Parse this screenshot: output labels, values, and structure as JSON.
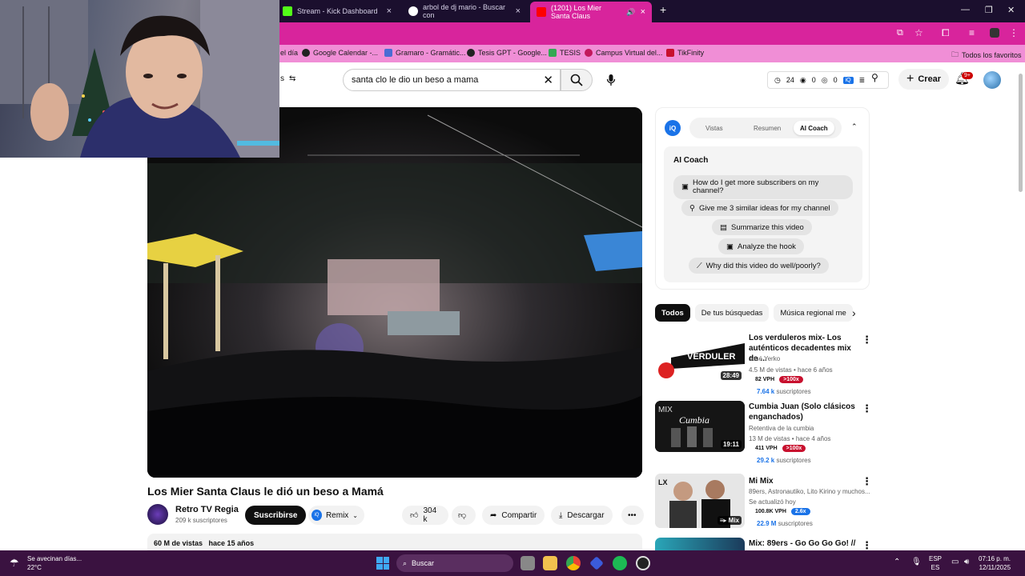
{
  "browser": {
    "tabs": [
      {
        "label": "Stream - Kick Dashboard",
        "color": "#53fc18"
      },
      {
        "label": "arbol de dj mario - Buscar con",
        "color": "#4285f4"
      },
      {
        "label": "(1201) Los Mier Santa Claus",
        "color": "#ff0000"
      }
    ],
    "bookmarks": [
      "el día",
      "Google Calendar -...",
      "Gramaro - Gramátic...",
      "Tesis GPT - Google...",
      "TESIS",
      "Campus Virtual del...",
      "TikFinity",
      "Todos los favoritos"
    ]
  },
  "header": {
    "filters_label": "s",
    "search_value": "santa clo le dio un beso a mama",
    "stats": {
      "clock": "24",
      "eye": "0",
      "views": "0"
    },
    "create_label": "Crear",
    "notif_badge": "9+"
  },
  "video": {
    "title": "Los Mier Santa Claus le dió un beso a Mamá",
    "channel": "Retro TV Regia",
    "channel_subs": "209 k suscriptores",
    "subscribe_label": "Suscribirse",
    "remix_label": "Remix",
    "likes": "304 k",
    "share_label": "Compartir",
    "download_label": "Descargar",
    "views": "60 M de vistas",
    "age": "hace 15 años"
  },
  "ai_panel": {
    "logo": "iQ",
    "tabs": [
      "Vistas",
      "Resumen",
      "AI Coach"
    ],
    "heading": "AI Coach",
    "questions": [
      "How do I get more subscribers on my channel?",
      "Give me 3 similar ideas for my channel",
      "Summarize this video",
      "Analyze the hook",
      "Why did this video do well/poorly?"
    ]
  },
  "chips": [
    "Todos",
    "De tus búsquedas",
    "Música regional me"
  ],
  "recommendations": [
    {
      "title": "Los verduleros mix- Los auténticos decadentes mix de ...",
      "channel": "José Yerko",
      "meta": "4.5 M de vistas • hace 6 años",
      "duration": "28:49",
      "vph": "82 VPH",
      "badge": ">100x",
      "subs_num": "7.64 k",
      "subs_label": "suscriptores"
    },
    {
      "title": "Cumbia Juan (Solo clásicos enganchados)",
      "channel": "Retentiva de la cumbia",
      "meta": "13 M de vistas • hace 4 años",
      "duration": "19:11",
      "vph": "411 VPH",
      "badge": ">100x",
      "subs_num": "29.2 k",
      "subs_label": "suscriptores"
    },
    {
      "title": "Mi Mix",
      "channel": "89ers, Astronautiko, Lito Kirino y muchos...",
      "meta": "Se actualizó hoy",
      "duration": "Mix",
      "vph": "100.8K VPH",
      "badge": "2.6x",
      "subs_num": "22.9 M",
      "subs_label": "suscriptores"
    },
    {
      "title": "Mix: 89ers - Go Go Go Go! //",
      "channel": "",
      "meta": "",
      "duration": "",
      "vph": "",
      "badge": "",
      "subs_num": "",
      "subs_label": ""
    }
  ],
  "taskbar": {
    "weather_text": "Se avecinan días...",
    "temperature": "22°C",
    "search_label": "Buscar",
    "lang": "ESP",
    "lang_sub": "ES",
    "time": "07:16 p. m.",
    "date": "12/11/2025"
  }
}
